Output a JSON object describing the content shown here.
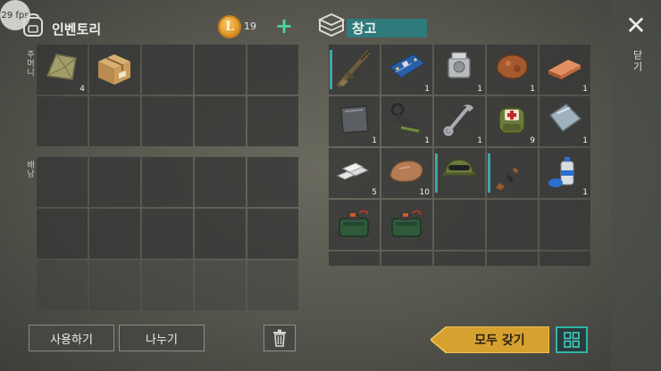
{
  "fps": "29 fps",
  "inventory": {
    "title": "인벤토리",
    "coins": "19",
    "plus": "+",
    "pockets_label": "주머니",
    "backpack_label": "배낭",
    "pockets": [
      {
        "icon": "cloth-bundle-icon",
        "count": "4"
      },
      {
        "icon": "cardboard-box-icon",
        "count": ""
      },
      {
        "icon": "",
        "count": ""
      },
      {
        "icon": "",
        "count": ""
      },
      {
        "icon": "",
        "count": ""
      },
      {
        "icon": "",
        "count": ""
      },
      {
        "icon": "",
        "count": ""
      },
      {
        "icon": "",
        "count": ""
      },
      {
        "icon": "",
        "count": ""
      },
      {
        "icon": "",
        "count": ""
      }
    ]
  },
  "storage": {
    "title": "창고",
    "items": [
      {
        "icon": "assault-rifle-icon",
        "count": "",
        "equipped": true
      },
      {
        "icon": "circuit-board-icon",
        "count": "1"
      },
      {
        "icon": "engine-part-icon",
        "count": "1"
      },
      {
        "icon": "copper-ore-icon",
        "count": "1"
      },
      {
        "icon": "copper-ingot-icon",
        "count": "1"
      },
      {
        "icon": "metal-plate-icon",
        "count": "1"
      },
      {
        "icon": "scope-icon",
        "count": "1"
      },
      {
        "icon": "wrench-icon",
        "count": "1"
      },
      {
        "icon": "medical-backpack-icon",
        "count": "9"
      },
      {
        "icon": "steel-sheet-icon",
        "count": "1"
      },
      {
        "icon": "silver-ingots-icon",
        "count": "5"
      },
      {
        "icon": "stone-ore-icon",
        "count": "10"
      },
      {
        "icon": "military-helmet-icon",
        "count": "",
        "equipped": true
      },
      {
        "icon": "ak-rifle-icon",
        "count": "",
        "equipped": true
      },
      {
        "icon": "spray-can-icon",
        "count": "1"
      },
      {
        "icon": "explosive-pack-icon",
        "count": ""
      },
      {
        "icon": "explosive-pack-icon",
        "count": ""
      }
    ]
  },
  "buttons": {
    "use": "사용하기",
    "split": "나누기",
    "take_all": "모두 갖기",
    "close": "닫기",
    "close_symbol": "✕"
  },
  "colors": {
    "accent_teal": "#2fb6a8",
    "take_all_gold": "#d6a12f",
    "storage_header": "#2f7b7c"
  }
}
